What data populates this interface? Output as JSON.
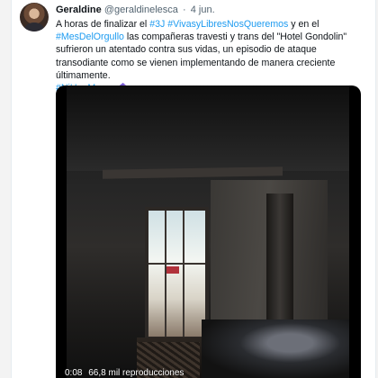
{
  "tweet": {
    "author_name": "Geraldine",
    "author_handle": "@geraldinelesca",
    "separator": "·",
    "date": "4 jun.",
    "text": {
      "p1": "A horas de finalizar el ",
      "tag1": "#3J",
      "p2": " ",
      "tag2": "#VivasyLibresNosQueremos",
      "p3": " y en el ",
      "tag3": "#MesDelOrgullo",
      "p4": " las compañeras travesti y trans del \"Hotel Gondolin\" sufrieron un atentado contra sus vidas, un episodio de ataque transodiante como se vienen implementando de manera creciente últimamente.",
      "tag4": "#NiUnaMenos",
      "emoji": "prism-emoji"
    },
    "video": {
      "time": "0:08",
      "views": "66,8 mil reproducciones"
    }
  },
  "colors": {
    "link": "#1d9bf0",
    "text": "#0f1419",
    "muted": "#536471"
  }
}
